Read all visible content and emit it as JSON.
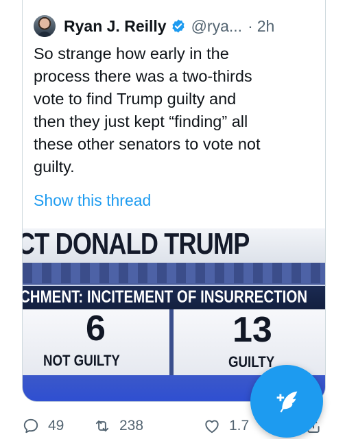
{
  "quoted_tweet": {
    "author_name": "Ryan J. Reilly",
    "handle": "@rya...",
    "separator": "·",
    "time": "2h",
    "text": "So strange how early in the\nprocess there was a two-thirds\nvote to find Trump guilty and\nthen they just kept “finding” all\nthese other senators to vote not\nguilty.",
    "show_thread_label": "Show this thread"
  },
  "media": {
    "headline": "CT DONALD TRUMP",
    "subheadline": "CHMENT: INCITEMENT OF INSURRECTION",
    "not_guilty_count": "6",
    "not_guilty_label": "NOT GUILTY",
    "guilty_count": "13",
    "guilty_label": "GUILTY"
  },
  "actions": {
    "replies": "49",
    "retweets": "238",
    "likes": "1.7",
    "reply_icon": "reply-icon",
    "retweet_icon": "retweet-icon",
    "like_icon": "heart-icon",
    "share_icon": "share-icon"
  },
  "compose": {
    "icon": "compose-tweet-icon"
  },
  "colors": {
    "accent": "#1d9bf0",
    "text": "#0f1419",
    "secondary": "#536471"
  }
}
